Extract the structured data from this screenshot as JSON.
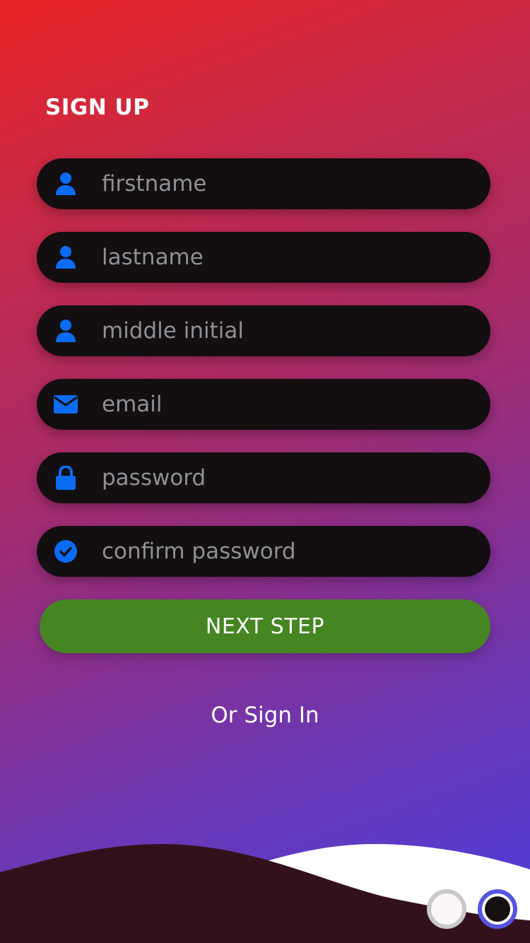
{
  "page": {
    "title": "SIGN UP"
  },
  "form": {
    "fields": [
      {
        "name": "firstname",
        "placeholder": "firstname",
        "value": "",
        "icon": "user-icon"
      },
      {
        "name": "lastname",
        "placeholder": "lastname",
        "value": "",
        "icon": "user-icon"
      },
      {
        "name": "middle_initial",
        "placeholder": "middle initial",
        "value": "",
        "icon": "user-icon"
      },
      {
        "name": "email",
        "placeholder": "email",
        "value": "",
        "icon": "envelope-icon"
      },
      {
        "name": "password",
        "placeholder": "password",
        "value": "",
        "icon": "lock-icon"
      },
      {
        "name": "confirm_password",
        "placeholder": "confirm password",
        "value": "",
        "icon": "check-circle-icon"
      }
    ],
    "next_label": "NEXT STEP",
    "signin_label": "Or Sign In"
  },
  "pager": {
    "total": 2,
    "active": 2
  },
  "colors": {
    "gradient_top": "#e82425",
    "gradient_bottom": "#4a3cdc",
    "field_bg": "#130e10",
    "icon": "#0a6cf5",
    "placeholder": "#8e9095",
    "button": "#458522",
    "wave_dark": "#33111c",
    "wave_light": "#ffffff",
    "pager_active_ring": "#5654e0"
  }
}
